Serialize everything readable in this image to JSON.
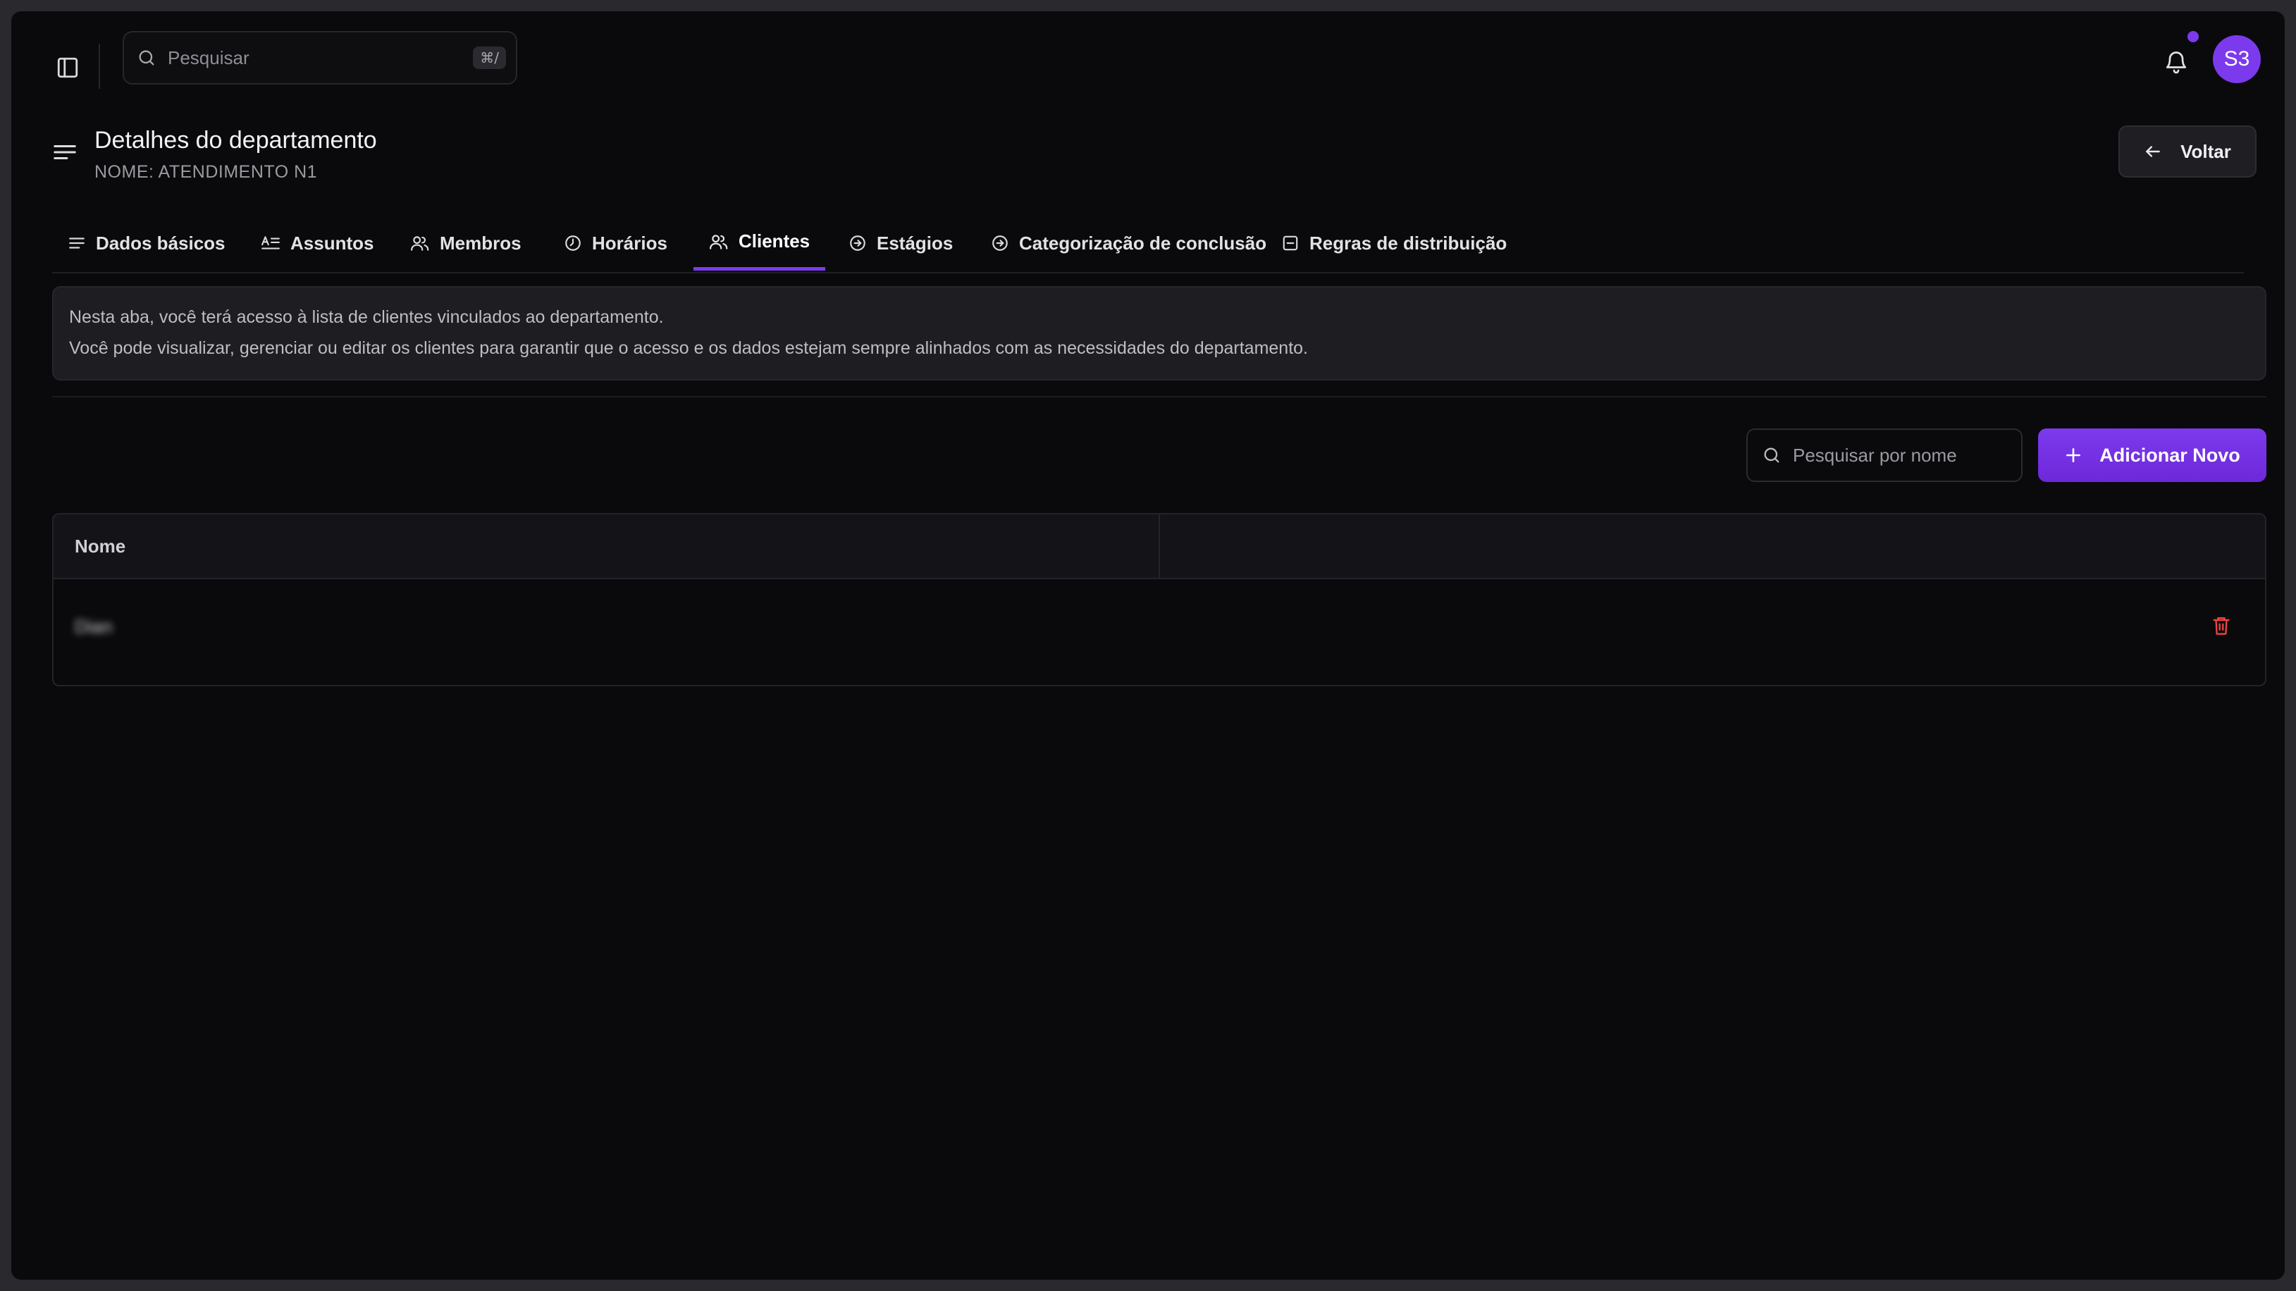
{
  "topbar": {
    "search_placeholder": "Pesquisar",
    "search_shortcut": "⌘/",
    "avatar_initials": "S3",
    "notification_dot_color": "#7c3aed"
  },
  "header": {
    "title": "Detalhes do departamento",
    "subtitle": "NOME: ATENDIMENTO N1",
    "back_label": "Voltar"
  },
  "tabs": [
    {
      "label": "Dados básicos",
      "icon": "lines-icon"
    },
    {
      "label": "Assuntos",
      "icon": "subjects-icon"
    },
    {
      "label": "Membros",
      "icon": "users-icon"
    },
    {
      "label": "Horários",
      "icon": "clock-icon"
    },
    {
      "label": "Clientes",
      "icon": "users-icon",
      "active": true
    },
    {
      "label": "Estágios",
      "icon": "arrow-circle-icon"
    },
    {
      "label": "Categorização de conclusão",
      "icon": "arrow-circle-icon"
    },
    {
      "label": "Regras de distribuição",
      "icon": "square-minus-icon"
    }
  ],
  "info": {
    "line1": "Nesta aba, você terá acesso à lista de clientes vinculados ao departamento.",
    "line2": "Você pode visualizar, gerenciar ou editar os clientes para garantir que o acesso e os dados estejam sempre alinhados com as necessidades do departamento."
  },
  "toolbar": {
    "search_placeholder": "Pesquisar por nome",
    "add_label": "Adicionar Novo"
  },
  "table": {
    "columns": [
      "Nome",
      ""
    ],
    "rows": [
      {
        "name": "Dian"
      }
    ]
  },
  "colors": {
    "accent": "#7c3aed",
    "danger": "#ef4444",
    "background": "#0a0a0c"
  }
}
